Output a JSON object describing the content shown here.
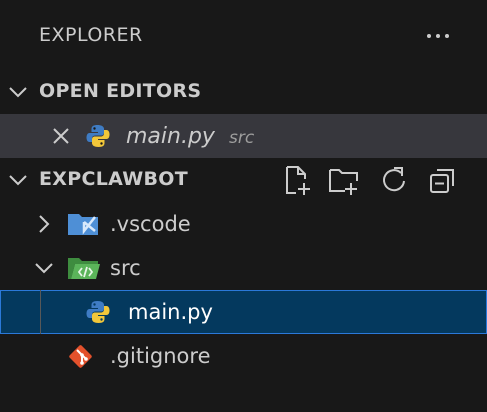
{
  "explorer": {
    "title": "EXPLORER",
    "more_actions_icon": "ellipsis-icon"
  },
  "open_editors": {
    "label": "OPEN EDITORS",
    "items": [
      {
        "file_name": "main.py",
        "folder": "src",
        "icon": "python-file-icon"
      }
    ]
  },
  "workspace": {
    "label": "EXPCLAWBOT",
    "actions": [
      "new-file-icon",
      "new-folder-icon",
      "refresh-icon",
      "collapse-all-icon"
    ],
    "tree": [
      {
        "name": ".vscode",
        "type": "folder",
        "expanded": false,
        "icon": "vscode-folder-icon"
      },
      {
        "name": "src",
        "type": "folder",
        "expanded": true,
        "icon": "src-folder-icon"
      },
      {
        "name": "main.py",
        "type": "file",
        "selected": true,
        "icon": "python-file-icon"
      },
      {
        "name": ".gitignore",
        "type": "file",
        "icon": "git-file-icon"
      }
    ]
  },
  "colors": {
    "background": "#181818",
    "selection": "#04395e",
    "selection_border": "#2b79d9",
    "active_editor_row": "#37373d",
    "text": "#cccccc",
    "muted_text": "#9d9d9d"
  }
}
